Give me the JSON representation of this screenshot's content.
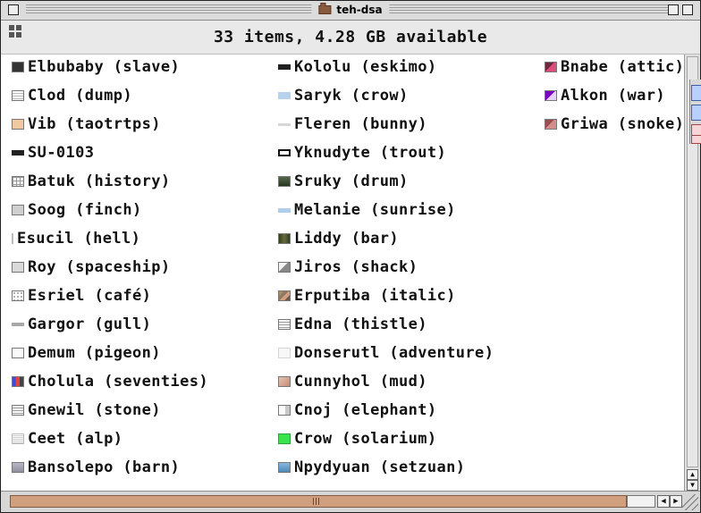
{
  "window": {
    "title": "teh-dsa",
    "status": "33 items, 4.28 GB available"
  },
  "icons": {
    "titlebar_folder": "folder-icon",
    "status_layout": "grid-view-icon",
    "vertical_up": "up-arrow-icon",
    "vertical_down": "down-arrow-icon",
    "horizontal_left": "left-arrow-icon",
    "horizontal_right": "right-arrow-icon",
    "resize": "resize-grip-icon"
  },
  "items": {
    "col1": [
      {
        "label": "Elbubaby (slave)",
        "thumb": "dark"
      },
      {
        "label": "Clod (dump)",
        "thumb": "doc"
      },
      {
        "label": "Vib (taotrtps)",
        "thumb": "beige"
      },
      {
        "label": "SU-0103",
        "thumb": "black-bar"
      },
      {
        "label": "Batuk (history)",
        "thumb": "grid"
      },
      {
        "label": "Soog (finch)",
        "thumb": "gray"
      },
      {
        "label": "Esucil (hell)",
        "thumb": "line"
      },
      {
        "label": "Roy (spaceship)",
        "thumb": "person"
      },
      {
        "label": "Esriel (café)",
        "thumb": "dotted"
      },
      {
        "label": "Gargor (gull)",
        "thumb": "small-line"
      },
      {
        "label": "Demum (pigeon)",
        "thumb": "white"
      },
      {
        "label": "Cholula (seventies)",
        "thumb": "blue-red"
      },
      {
        "label": "Gnewil (stone)",
        "thumb": "text-lines"
      },
      {
        "label": "Ceet (alp)",
        "thumb": "text"
      },
      {
        "label": "Bansolepo (barn)",
        "thumb": "building"
      }
    ],
    "col2": [
      {
        "label": "Kololu (eskimo)",
        "thumb": "black-bar"
      },
      {
        "label": "Saryk (crow)",
        "thumb": "sky"
      },
      {
        "label": "Fleren (bunny)",
        "thumb": "pale-line"
      },
      {
        "label": "Yknudyte (trout)",
        "thumb": "white-box"
      },
      {
        "label": "Sruky (drum)",
        "thumb": "green-dark"
      },
      {
        "label": "Melanie (sunrise)",
        "thumb": "sunrise"
      },
      {
        "label": "Liddy (bar)",
        "thumb": "dark-green"
      },
      {
        "label": "Jiros (shack)",
        "thumb": "shack"
      },
      {
        "label": "Erputiba (italic)",
        "thumb": "mosaic"
      },
      {
        "label": "Edna (thistle)",
        "thumb": "text-lines"
      },
      {
        "label": "Donserutl (adventure)",
        "thumb": "pale-box"
      },
      {
        "label": "Cunnyhol (mud)",
        "thumb": "mud"
      },
      {
        "label": "Cnoj (elephant)",
        "thumb": "elephant"
      },
      {
        "label": "Crow (solarium)",
        "thumb": "green"
      },
      {
        "label": "Npydyuan (setzuan)",
        "thumb": "setzuan"
      }
    ],
    "col3": [
      {
        "label": "Bnabe (attic)",
        "thumb": "attic"
      },
      {
        "label": "Alkon (war)",
        "thumb": "war"
      },
      {
        "label": "Griwa (snoke)",
        "thumb": "snoke"
      }
    ]
  },
  "scrollbars": {
    "vertical_up": "▲",
    "vertical_down": "▼",
    "horizontal_left": "◀",
    "horizontal_right": "▶"
  }
}
